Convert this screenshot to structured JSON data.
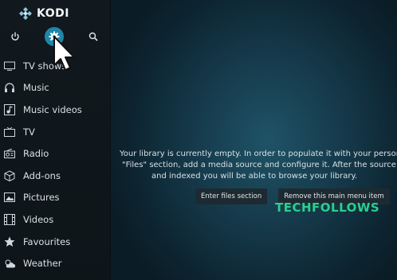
{
  "app": {
    "name": "KODI"
  },
  "top_buttons": [
    {
      "name": "power-icon"
    },
    {
      "name": "settings-icon",
      "active": true
    },
    {
      "name": "search-icon"
    }
  ],
  "sidebar": {
    "items": [
      {
        "label": "TV shows",
        "icon": "tv-show-icon"
      },
      {
        "label": "Music",
        "icon": "headphones-icon"
      },
      {
        "label": "Music videos",
        "icon": "music-video-icon"
      },
      {
        "label": "TV",
        "icon": "tv-icon"
      },
      {
        "label": "Radio",
        "icon": "radio-icon"
      },
      {
        "label": "Add-ons",
        "icon": "addons-box-icon"
      },
      {
        "label": "Pictures",
        "icon": "picture-icon"
      },
      {
        "label": "Videos",
        "icon": "film-icon"
      },
      {
        "label": "Favourites",
        "icon": "star-icon"
      },
      {
        "label": "Weather",
        "icon": "weather-icon"
      }
    ]
  },
  "main": {
    "message_lines": [
      "Your library is currently empty. In order to populate it with your persona",
      "\"Files\" section, add a media source and configure it. After the source ha",
      "and indexed you will be able to browse your library."
    ],
    "buttons": {
      "enter_files": "Enter files section",
      "remove_item": "Remove this main menu item"
    },
    "watermark": "TECHFOLLOWS"
  },
  "colors": {
    "accent": "#1f86a8",
    "sidebar_bg": "#11191e",
    "main_bg": "#15394a",
    "watermark": "#2bd08c"
  }
}
